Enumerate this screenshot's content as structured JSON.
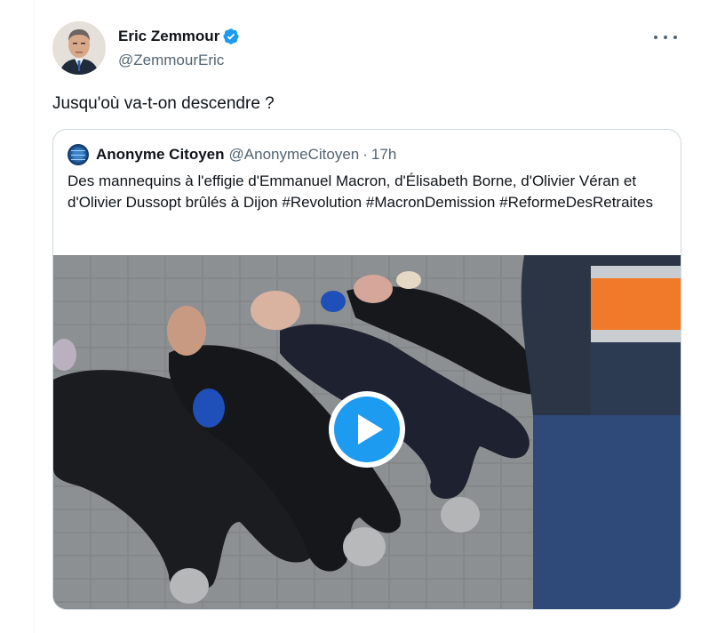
{
  "tweet": {
    "author": {
      "display_name": "Eric Zemmour",
      "handle": "@ZemmourEric",
      "verified": true,
      "verified_color": "#1d9bf0"
    },
    "text": "Jusqu'où va-t-on descendre ?",
    "more_icon": "more-horizontal-icon",
    "quoted": {
      "author": {
        "display_name": "Anonyme Citoyen",
        "handle": "@AnonymeCitoyen",
        "separator": "·",
        "time": "17h"
      },
      "text_plain": "Des mannequins à l'effigie d'Emmanuel Macron, d'Élisabeth Borne, d'Olivier Véran et d'Olivier Dussopt brûlés à Dijon ",
      "hashtags": [
        "#Revolution",
        "#MacronDemission",
        "#ReformeDesRetraites"
      ],
      "media": {
        "type": "video",
        "play_icon": "play-icon",
        "play_color": "#1d9bf0"
      }
    }
  },
  "colors": {
    "text": "#0f1419",
    "secondary": "#536471",
    "border": "#cfd9de"
  }
}
